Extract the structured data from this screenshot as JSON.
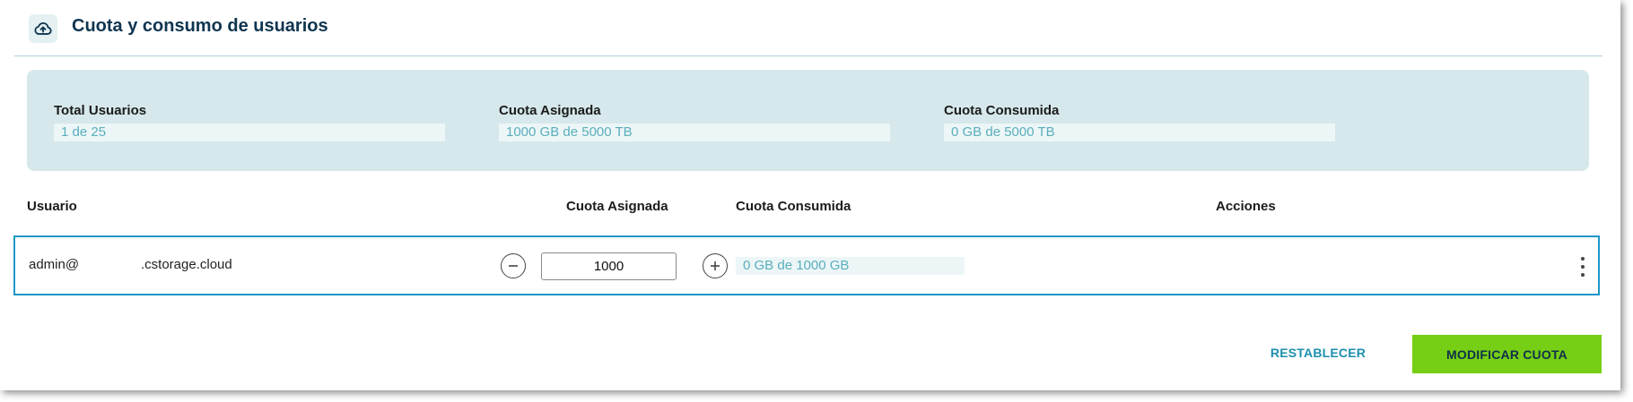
{
  "header": {
    "title": "Cuota y consumo de usuarios",
    "icon": "cloud-upload-icon"
  },
  "summary": {
    "total_users": {
      "label": "Total Usuarios",
      "value": "1 de 25"
    },
    "assigned_quota": {
      "label": "Cuota Asignada",
      "value": "1000 GB de 5000 TB"
    },
    "consumed_quota": {
      "label": "Cuota Consumida",
      "value": "0 GB de 5000 TB"
    }
  },
  "table": {
    "columns": [
      "Usuario",
      "Cuota Asignada",
      "Cuota Consumida",
      "Acciones"
    ],
    "rows": [
      {
        "user_prefix": "admin@",
        "user_domain": ".cstorage.cloud",
        "assigned": "1000",
        "consumed": "0 GB de 1000 GB"
      }
    ]
  },
  "actions": {
    "reset_label": "RESTABLECER",
    "modify_label": "MODIFICAR CUOTA"
  },
  "colors": {
    "accent_green": "#76cf14",
    "accent_blue": "#1e97c8",
    "summary_bg": "#d6e8eb",
    "value_text": "#58aebc"
  }
}
